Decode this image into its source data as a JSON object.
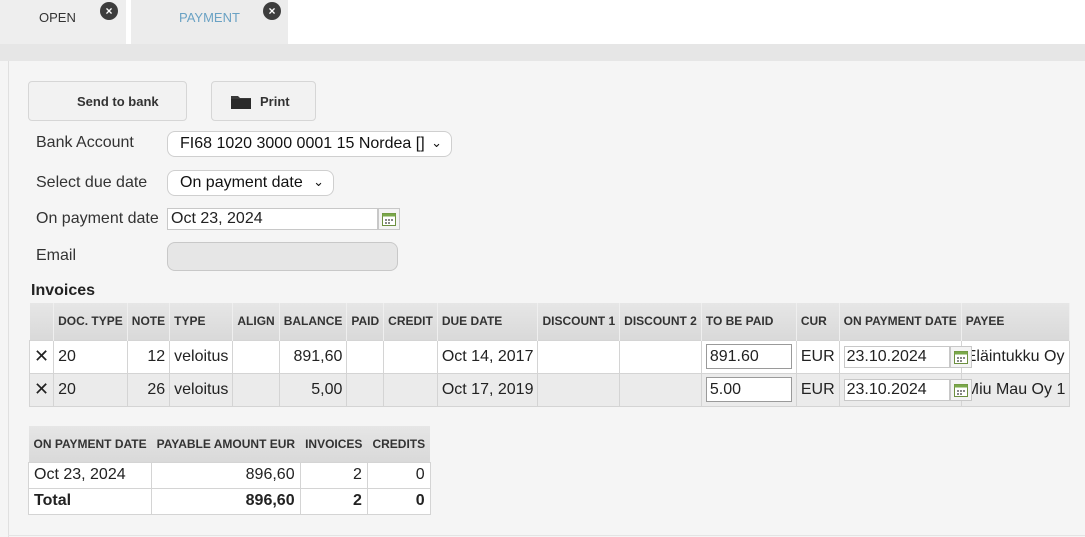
{
  "tabs": [
    {
      "label": "OPEN"
    },
    {
      "label": "PAYMENT"
    }
  ],
  "toolbar": {
    "send_label": "Send to bank",
    "print_label": "Print"
  },
  "form": {
    "bank_account_label": "Bank Account",
    "bank_account_value": "FI68 1020 3000 0001 15 Nordea []",
    "due_date_label": "Select due date",
    "due_date_value": "On payment date",
    "payment_date_label": "On payment date",
    "payment_date_value": "Oct 23, 2024",
    "email_label": "Email",
    "email_value": ""
  },
  "invoices": {
    "title": "Invoices",
    "columns": [
      "DOC. TYPE",
      "NOTE",
      "TYPE",
      "ALIGN",
      "BALANCE",
      "PAID",
      "CREDIT",
      "DUE DATE",
      "DISCOUNT 1",
      "DISCOUNT 2",
      "TO BE PAID",
      "CUR",
      "ON PAYMENT DATE",
      "PAYEE"
    ],
    "rows": [
      {
        "doc_type": "20",
        "note": "12",
        "type": "veloitus",
        "align": "",
        "balance": "891,60",
        "paid": "",
        "credit": "",
        "due_date": "Oct 14, 2017",
        "discount1": "",
        "discount2": "",
        "to_be_paid": "891.60",
        "cur": "EUR",
        "on_payment_date": "23.10.2024",
        "payee": "Eläintukku Oy"
      },
      {
        "doc_type": "20",
        "note": "26",
        "type": "veloitus",
        "align": "",
        "balance": "5,00",
        "paid": "",
        "credit": "",
        "due_date": "Oct 17, 2019",
        "discount1": "",
        "discount2": "",
        "to_be_paid": "5.00",
        "cur": "EUR",
        "on_payment_date": "23.10.2024",
        "payee": "Miu Mau Oy 1"
      }
    ]
  },
  "summary": {
    "columns": [
      "ON PAYMENT DATE",
      "PAYABLE AMOUNT EUR",
      "INVOICES",
      "CREDITS"
    ],
    "row": {
      "date": "Oct 23, 2024",
      "amount": "896,60",
      "invoices": "2",
      "credits": "0"
    },
    "total": {
      "label": "Total",
      "amount": "896,60",
      "invoices": "2",
      "credits": "0"
    }
  },
  "icons": {
    "close": "close-icon",
    "folder": "folder-icon",
    "calendar": "calendar-icon",
    "remove": "remove-row-icon",
    "chevron": "chevron-down-icon"
  },
  "colors": {
    "active_tab_text": "#6aa2c4",
    "panel_bg": "#f5f5f5",
    "header_bg": "#dddddd"
  }
}
